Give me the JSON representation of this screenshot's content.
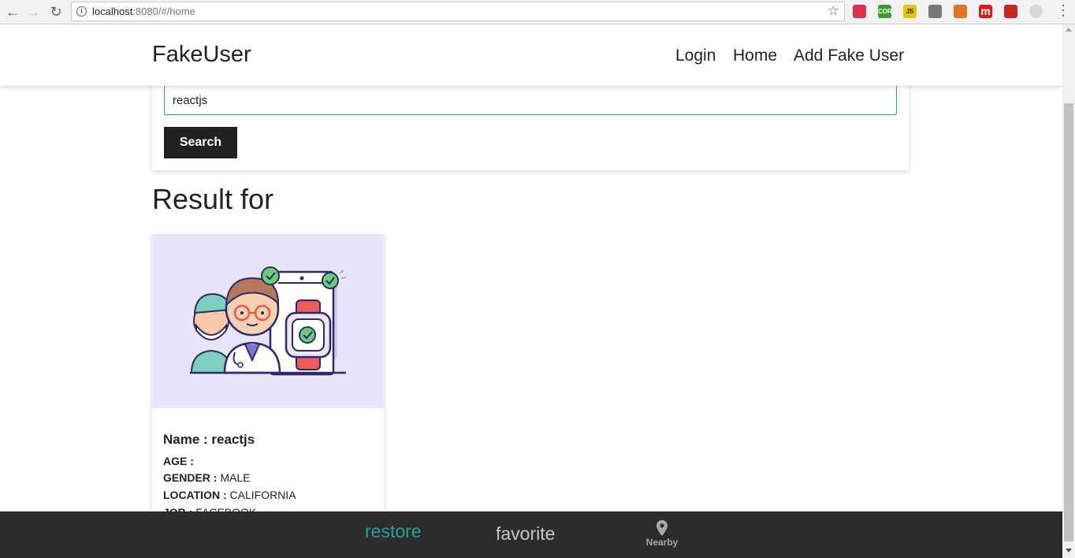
{
  "browser": {
    "url_host": "localhost",
    "url_path": ":8080/#/home",
    "extensions": [
      {
        "icon": "pocket-icon",
        "color": "#d8324c",
        "text": ""
      },
      {
        "icon": "cors-icon",
        "color": "#3c9a2c",
        "text": "CORS"
      },
      {
        "icon": "js-icon",
        "color": "#e8c400",
        "text": "JS"
      },
      {
        "icon": "ghost-icon",
        "color": "#777777",
        "text": ""
      },
      {
        "icon": "metamask-icon",
        "color": "#e27626",
        "text": ""
      },
      {
        "icon": "m-icon",
        "color": "#d81b1b",
        "text": "m"
      },
      {
        "icon": "puzzle-icon",
        "color": "#c62828",
        "text": ""
      },
      {
        "icon": "disabled-icon",
        "color": "#d8d8d8",
        "text": ""
      }
    ]
  },
  "header": {
    "brand": "FakeUser",
    "nav": [
      "Login",
      "Home",
      "Add Fake User"
    ]
  },
  "search": {
    "value": "reactjs",
    "button_label": "Search"
  },
  "results": {
    "title": "Result for"
  },
  "user": {
    "name": "Name : reactjs",
    "fields": [
      {
        "key": "AGE :",
        "value": ""
      },
      {
        "key": "GENDER :",
        "value": "MALE"
      },
      {
        "key": "LOCATION :",
        "value": "CALIFORNIA"
      },
      {
        "key": "JOB :",
        "value": "FACEBOOK"
      }
    ]
  },
  "bottom_nav": {
    "restore": "restore",
    "favorite": "favorite",
    "nearby": "Nearby",
    "active": "restore",
    "accent_color": "#26a69a"
  }
}
